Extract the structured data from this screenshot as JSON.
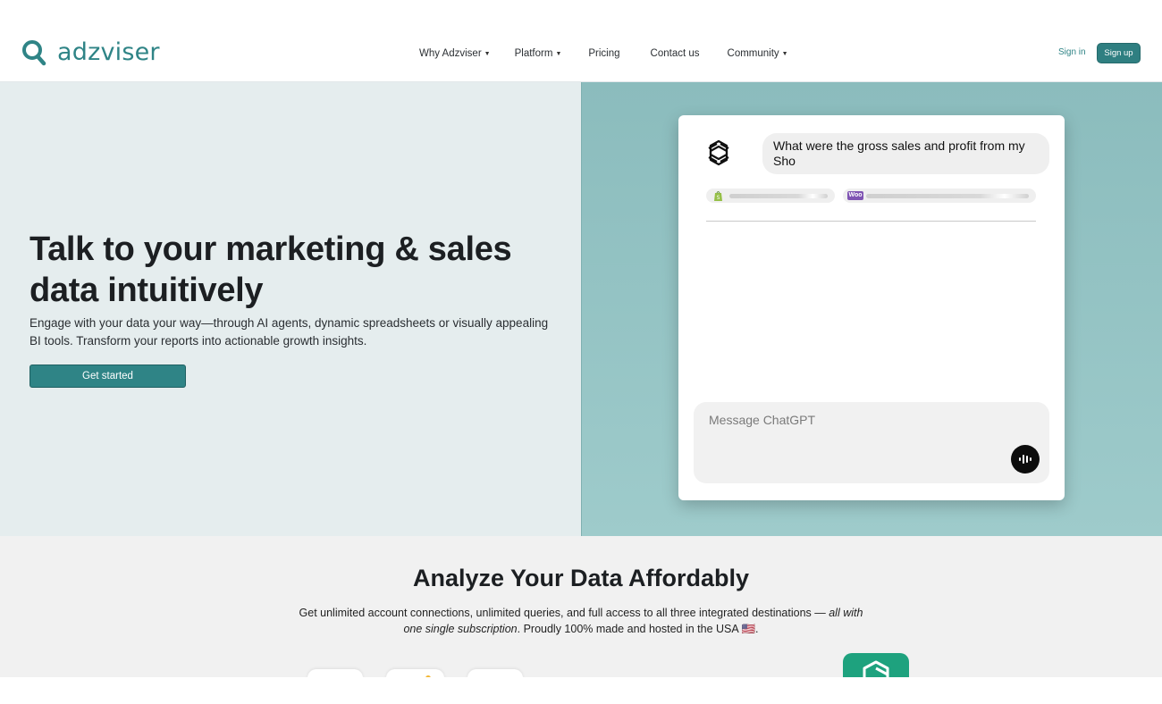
{
  "brand": {
    "name": "adzviser",
    "color": "#2f8486"
  },
  "nav": {
    "items": [
      {
        "label": "Why Adzviser",
        "dropdown": true
      },
      {
        "label": "Platform",
        "dropdown": true
      },
      {
        "label": "Pricing",
        "dropdown": false
      },
      {
        "label": "Contact us",
        "dropdown": false
      },
      {
        "label": "Community",
        "dropdown": true
      }
    ],
    "sign_in": "Sign in",
    "sign_up": "Sign up"
  },
  "hero": {
    "title": "Talk to your marketing & sales data intuitively",
    "subtitle": "Engage with your data your way—through AI agents, dynamic spreadsheets or visually appealing BI tools. Transform your reports into actionable growth insights.",
    "cta": "Get started"
  },
  "chat": {
    "question": "What were the gross sales and profit from my Sho",
    "sources": [
      {
        "icon": "shopify-icon"
      },
      {
        "icon": "woocommerce-icon",
        "badge": "Woo"
      }
    ],
    "input_placeholder": "Message ChatGPT"
  },
  "analyze": {
    "title": "Analyze Your Data Affordably",
    "subtitle_before": "Get unlimited account connections, unlimited queries, and full access to all three integrated destinations — ",
    "subtitle_emph": "all with one single subscription",
    "subtitle_after": ". Proudly 100% made and hosted in the USA 🇺🇸."
  }
}
